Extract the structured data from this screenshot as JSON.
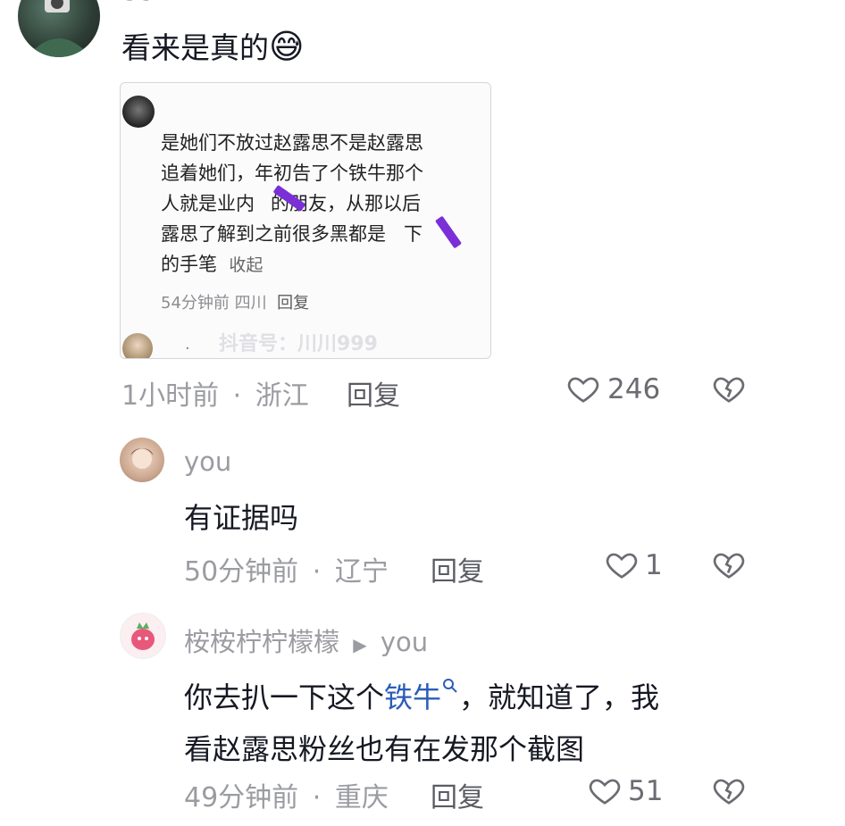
{
  "top_comment": {
    "username_partial": "t t",
    "text": "看来是真的",
    "emoji": "😅",
    "quoted_card": {
      "text_lines": [
        "是她们不放过赵露思不是赵露思",
        "追着她们，年初告了个铁牛那个",
        "人就是业内",
        "的朋友，从那以后",
        "露思了解到之前很多黑都是",
        "下",
        "的手笔"
      ],
      "collapse_label": "收起",
      "meta_time": "54分钟前",
      "meta_location": "四川",
      "meta_reply": "回复",
      "next_dot": ".",
      "watermark": "抖音号：川川999"
    },
    "time": "1小时前",
    "separator": "·",
    "location": "浙江",
    "reply": "回复",
    "likes": "246"
  },
  "reply_1": {
    "username": "you",
    "text": "有证据吗",
    "time": "50分钟前",
    "separator": "·",
    "location": "辽宁",
    "reply": "回复",
    "likes": "1"
  },
  "reply_2": {
    "username": "桉桉柠柠檬檬",
    "reply_to_arrow": "▶",
    "reply_to": "you",
    "text_before_link": "你去扒一下这个",
    "link_text": "铁牛",
    "text_after_link": "，就知道了，我",
    "text_line2": "看赵露思粉丝也有在发那个截图",
    "time": "49分钟前",
    "separator": "·",
    "location": "重庆",
    "reply": "回复",
    "likes": "51"
  },
  "colors": {
    "text": "#161823",
    "meta": "#9b9ca1",
    "link": "#2b5db8",
    "mark": "#7b2fd6"
  }
}
